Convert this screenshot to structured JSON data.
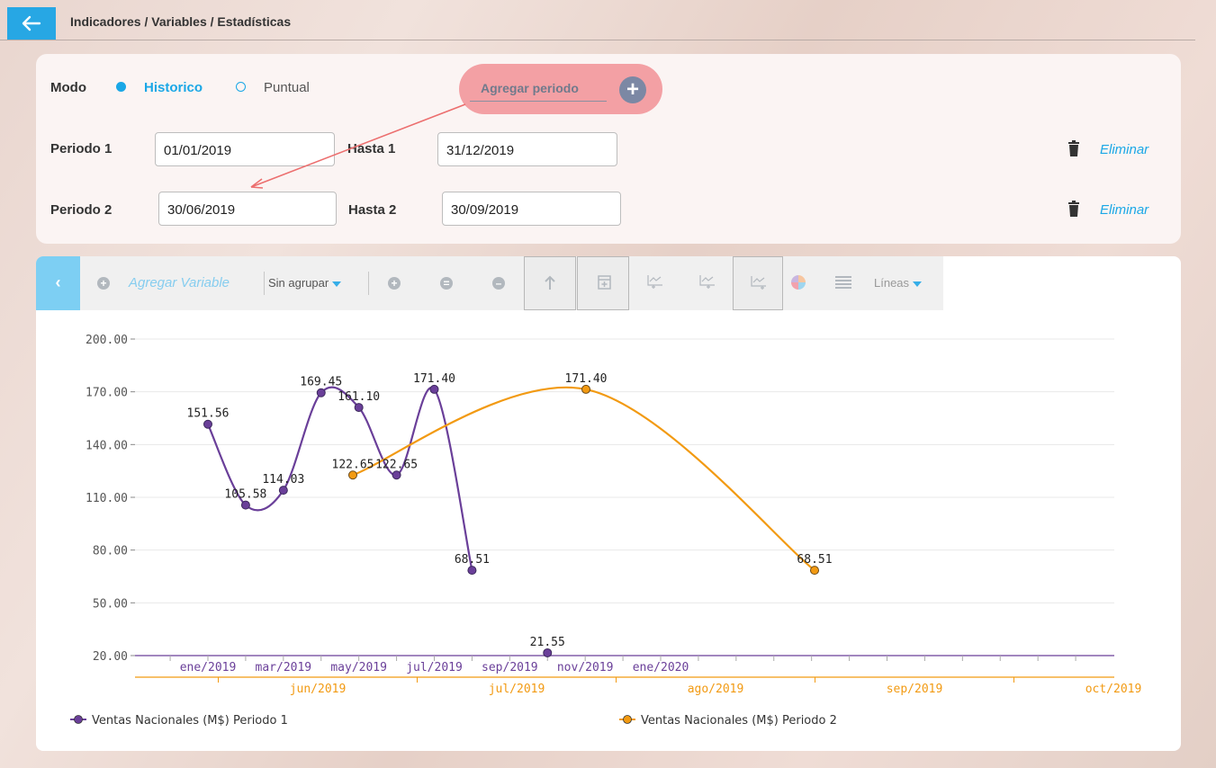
{
  "header": {
    "back_icon": "arrow-left-icon",
    "breadcrumb": "Indicadores / Variables / Estadísticas"
  },
  "filters": {
    "mode_label": "Modo",
    "mode_options": [
      {
        "label": "Historico",
        "selected": true
      },
      {
        "label": "Puntual",
        "selected": false
      }
    ],
    "add_period_label": "Agregar periodo",
    "periods": [
      {
        "from_label": "Periodo 1",
        "from_value": "01/01/2019",
        "to_label": "Hasta 1",
        "to_value": "31/12/2019",
        "delete_label": "Eliminar"
      },
      {
        "from_label": "Periodo 2",
        "from_value": "30/06/2019",
        "to_label": "Hasta 2",
        "to_value": "30/09/2019",
        "delete_label": "Eliminar"
      }
    ]
  },
  "toolbar": {
    "add_variable": "Agregar Variable",
    "group_select": "Sin agrupar",
    "chart_type_select": "Líneas",
    "accent_color": "#36aee8"
  },
  "chart_data": {
    "type": "line",
    "ylim": [
      20,
      200
    ],
    "y_ticks": [
      "200.00",
      "170.00",
      "140.00",
      "110.00",
      "80.00",
      "50.00",
      "20.00"
    ],
    "x_axis_top": [
      "ene/2019",
      "mar/2019",
      "may/2019",
      "jul/2019",
      "sep/2019",
      "nov/2019",
      "ene/2020"
    ],
    "x_axis_bottom": [
      "jun/2019",
      "jul/2019",
      "ago/2019",
      "sep/2019",
      "oct/2019"
    ],
    "series": [
      {
        "name": "Ventas Nacionales (M$) Periodo 1",
        "color": "#6a3f99",
        "points": [
          {
            "x": "2019-01",
            "y": 151.56,
            "label": "151.56"
          },
          {
            "x": "2019-02",
            "y": 105.58,
            "label": "105.58"
          },
          {
            "x": "2019-03",
            "y": 114.03,
            "label": "114.03"
          },
          {
            "x": "2019-04",
            "y": 169.45,
            "label": "169.45"
          },
          {
            "x": "2019-05",
            "y": 161.1,
            "label": "161.10"
          },
          {
            "x": "2019-06",
            "y": 122.65,
            "label": "122.65"
          },
          {
            "x": "2019-07",
            "y": 171.4,
            "label": "171.40"
          },
          {
            "x": "2019-08",
            "y": 68.51,
            "label": "68.51"
          },
          {
            "x": "2019-10",
            "y": 21.55,
            "label": "21.55"
          }
        ]
      },
      {
        "name": "Ventas Nacionales (M$) Periodo 2",
        "color": "#f29a12",
        "points": [
          {
            "x": "2019-06",
            "y": 122.65,
            "label": "122.65"
          },
          {
            "x": "2019-07",
            "y": 171.4,
            "label": "171.40"
          },
          {
            "x": "2019-08",
            "y": 68.51,
            "label": "68.51"
          }
        ]
      }
    ]
  }
}
